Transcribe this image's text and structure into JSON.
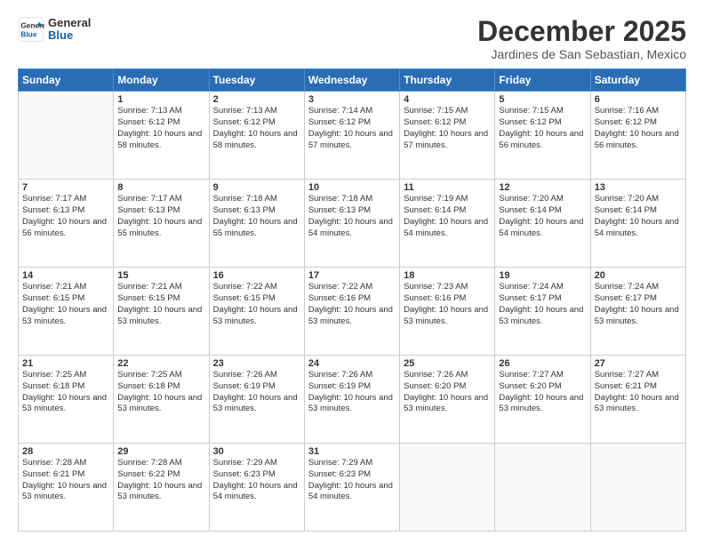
{
  "header": {
    "logo_line1": "General",
    "logo_line2": "Blue",
    "month": "December 2025",
    "location": "Jardines de San Sebastian, Mexico"
  },
  "weekdays": [
    "Sunday",
    "Monday",
    "Tuesday",
    "Wednesday",
    "Thursday",
    "Friday",
    "Saturday"
  ],
  "weeks": [
    [
      {
        "day": "",
        "info": ""
      },
      {
        "day": "1",
        "info": "Sunrise: 7:13 AM\nSunset: 6:12 PM\nDaylight: 10 hours\nand 58 minutes."
      },
      {
        "day": "2",
        "info": "Sunrise: 7:13 AM\nSunset: 6:12 PM\nDaylight: 10 hours\nand 58 minutes."
      },
      {
        "day": "3",
        "info": "Sunrise: 7:14 AM\nSunset: 6:12 PM\nDaylight: 10 hours\nand 57 minutes."
      },
      {
        "day": "4",
        "info": "Sunrise: 7:15 AM\nSunset: 6:12 PM\nDaylight: 10 hours\nand 57 minutes."
      },
      {
        "day": "5",
        "info": "Sunrise: 7:15 AM\nSunset: 6:12 PM\nDaylight: 10 hours\nand 56 minutes."
      },
      {
        "day": "6",
        "info": "Sunrise: 7:16 AM\nSunset: 6:12 PM\nDaylight: 10 hours\nand 56 minutes."
      }
    ],
    [
      {
        "day": "7",
        "info": "Sunrise: 7:17 AM\nSunset: 6:13 PM\nDaylight: 10 hours\nand 56 minutes."
      },
      {
        "day": "8",
        "info": "Sunrise: 7:17 AM\nSunset: 6:13 PM\nDaylight: 10 hours\nand 55 minutes."
      },
      {
        "day": "9",
        "info": "Sunrise: 7:18 AM\nSunset: 6:13 PM\nDaylight: 10 hours\nand 55 minutes."
      },
      {
        "day": "10",
        "info": "Sunrise: 7:18 AM\nSunset: 6:13 PM\nDaylight: 10 hours\nand 54 minutes."
      },
      {
        "day": "11",
        "info": "Sunrise: 7:19 AM\nSunset: 6:14 PM\nDaylight: 10 hours\nand 54 minutes."
      },
      {
        "day": "12",
        "info": "Sunrise: 7:20 AM\nSunset: 6:14 PM\nDaylight: 10 hours\nand 54 minutes."
      },
      {
        "day": "13",
        "info": "Sunrise: 7:20 AM\nSunset: 6:14 PM\nDaylight: 10 hours\nand 54 minutes."
      }
    ],
    [
      {
        "day": "14",
        "info": "Sunrise: 7:21 AM\nSunset: 6:15 PM\nDaylight: 10 hours\nand 53 minutes."
      },
      {
        "day": "15",
        "info": "Sunrise: 7:21 AM\nSunset: 6:15 PM\nDaylight: 10 hours\nand 53 minutes."
      },
      {
        "day": "16",
        "info": "Sunrise: 7:22 AM\nSunset: 6:15 PM\nDaylight: 10 hours\nand 53 minutes."
      },
      {
        "day": "17",
        "info": "Sunrise: 7:22 AM\nSunset: 6:16 PM\nDaylight: 10 hours\nand 53 minutes."
      },
      {
        "day": "18",
        "info": "Sunrise: 7:23 AM\nSunset: 6:16 PM\nDaylight: 10 hours\nand 53 minutes."
      },
      {
        "day": "19",
        "info": "Sunrise: 7:24 AM\nSunset: 6:17 PM\nDaylight: 10 hours\nand 53 minutes."
      },
      {
        "day": "20",
        "info": "Sunrise: 7:24 AM\nSunset: 6:17 PM\nDaylight: 10 hours\nand 53 minutes."
      }
    ],
    [
      {
        "day": "21",
        "info": "Sunrise: 7:25 AM\nSunset: 6:18 PM\nDaylight: 10 hours\nand 53 minutes."
      },
      {
        "day": "22",
        "info": "Sunrise: 7:25 AM\nSunset: 6:18 PM\nDaylight: 10 hours\nand 53 minutes."
      },
      {
        "day": "23",
        "info": "Sunrise: 7:26 AM\nSunset: 6:19 PM\nDaylight: 10 hours\nand 53 minutes."
      },
      {
        "day": "24",
        "info": "Sunrise: 7:26 AM\nSunset: 6:19 PM\nDaylight: 10 hours\nand 53 minutes."
      },
      {
        "day": "25",
        "info": "Sunrise: 7:26 AM\nSunset: 6:20 PM\nDaylight: 10 hours\nand 53 minutes."
      },
      {
        "day": "26",
        "info": "Sunrise: 7:27 AM\nSunset: 6:20 PM\nDaylight: 10 hours\nand 53 minutes."
      },
      {
        "day": "27",
        "info": "Sunrise: 7:27 AM\nSunset: 6:21 PM\nDaylight: 10 hours\nand 53 minutes."
      }
    ],
    [
      {
        "day": "28",
        "info": "Sunrise: 7:28 AM\nSunset: 6:21 PM\nDaylight: 10 hours\nand 53 minutes."
      },
      {
        "day": "29",
        "info": "Sunrise: 7:28 AM\nSunset: 6:22 PM\nDaylight: 10 hours\nand 53 minutes."
      },
      {
        "day": "30",
        "info": "Sunrise: 7:29 AM\nSunset: 6:23 PM\nDaylight: 10 hours\nand 54 minutes."
      },
      {
        "day": "31",
        "info": "Sunrise: 7:29 AM\nSunset: 6:23 PM\nDaylight: 10 hours\nand 54 minutes."
      },
      {
        "day": "",
        "info": ""
      },
      {
        "day": "",
        "info": ""
      },
      {
        "day": "",
        "info": ""
      }
    ]
  ]
}
